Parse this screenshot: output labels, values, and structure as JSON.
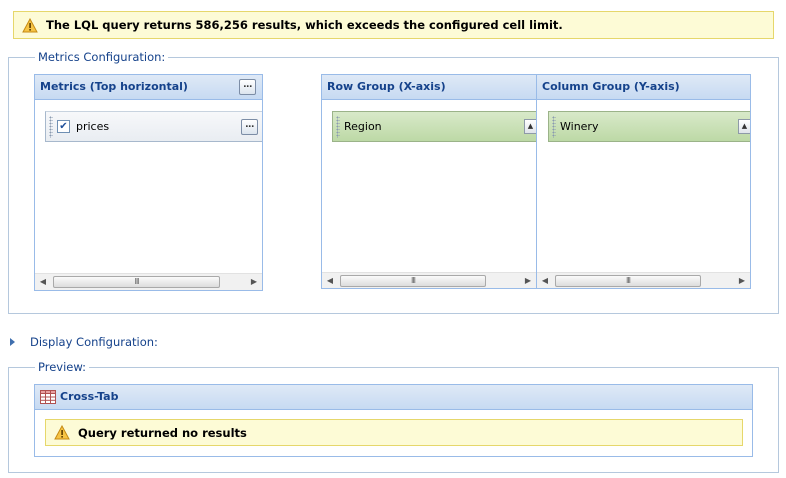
{
  "top_warning": {
    "text": "The LQL query returns 586,256 results, which exceeds the configured cell limit.",
    "icon": "warning-icon"
  },
  "metrics_config": {
    "legend": "Metrics Configuration:",
    "metrics_panel": {
      "title": "Metrics (Top horizontal)",
      "tool_label": "...",
      "items": [
        {
          "label": "prices",
          "checked": true,
          "check_glyph": "✔",
          "tool_label": "..."
        }
      ]
    },
    "row_group_panel": {
      "title": "Row Group (X-axis)",
      "items": [
        {
          "label": "Region",
          "sort_glyph": "▲"
        }
      ]
    },
    "column_group_panel": {
      "title": "Column Group (Y-axis)",
      "items": [
        {
          "label": "Winery",
          "sort_glyph": "▲"
        }
      ]
    },
    "scrollbar": {
      "left_arrow": "◀",
      "right_arrow": "▶",
      "thumb_grip": "III"
    }
  },
  "display_config": {
    "label": "Display Configuration:",
    "expanded": false
  },
  "preview": {
    "legend": "Preview:",
    "panel_title": "Cross-Tab",
    "panel_icon": "table-icon",
    "message": "Query returned no results",
    "message_icon": "warning-icon"
  },
  "colors": {
    "accent_text": "#15428b",
    "panel_border": "#99bbe8",
    "warning_bg": "#fdfbd6",
    "group_item_bg": "#c9e0b4"
  }
}
